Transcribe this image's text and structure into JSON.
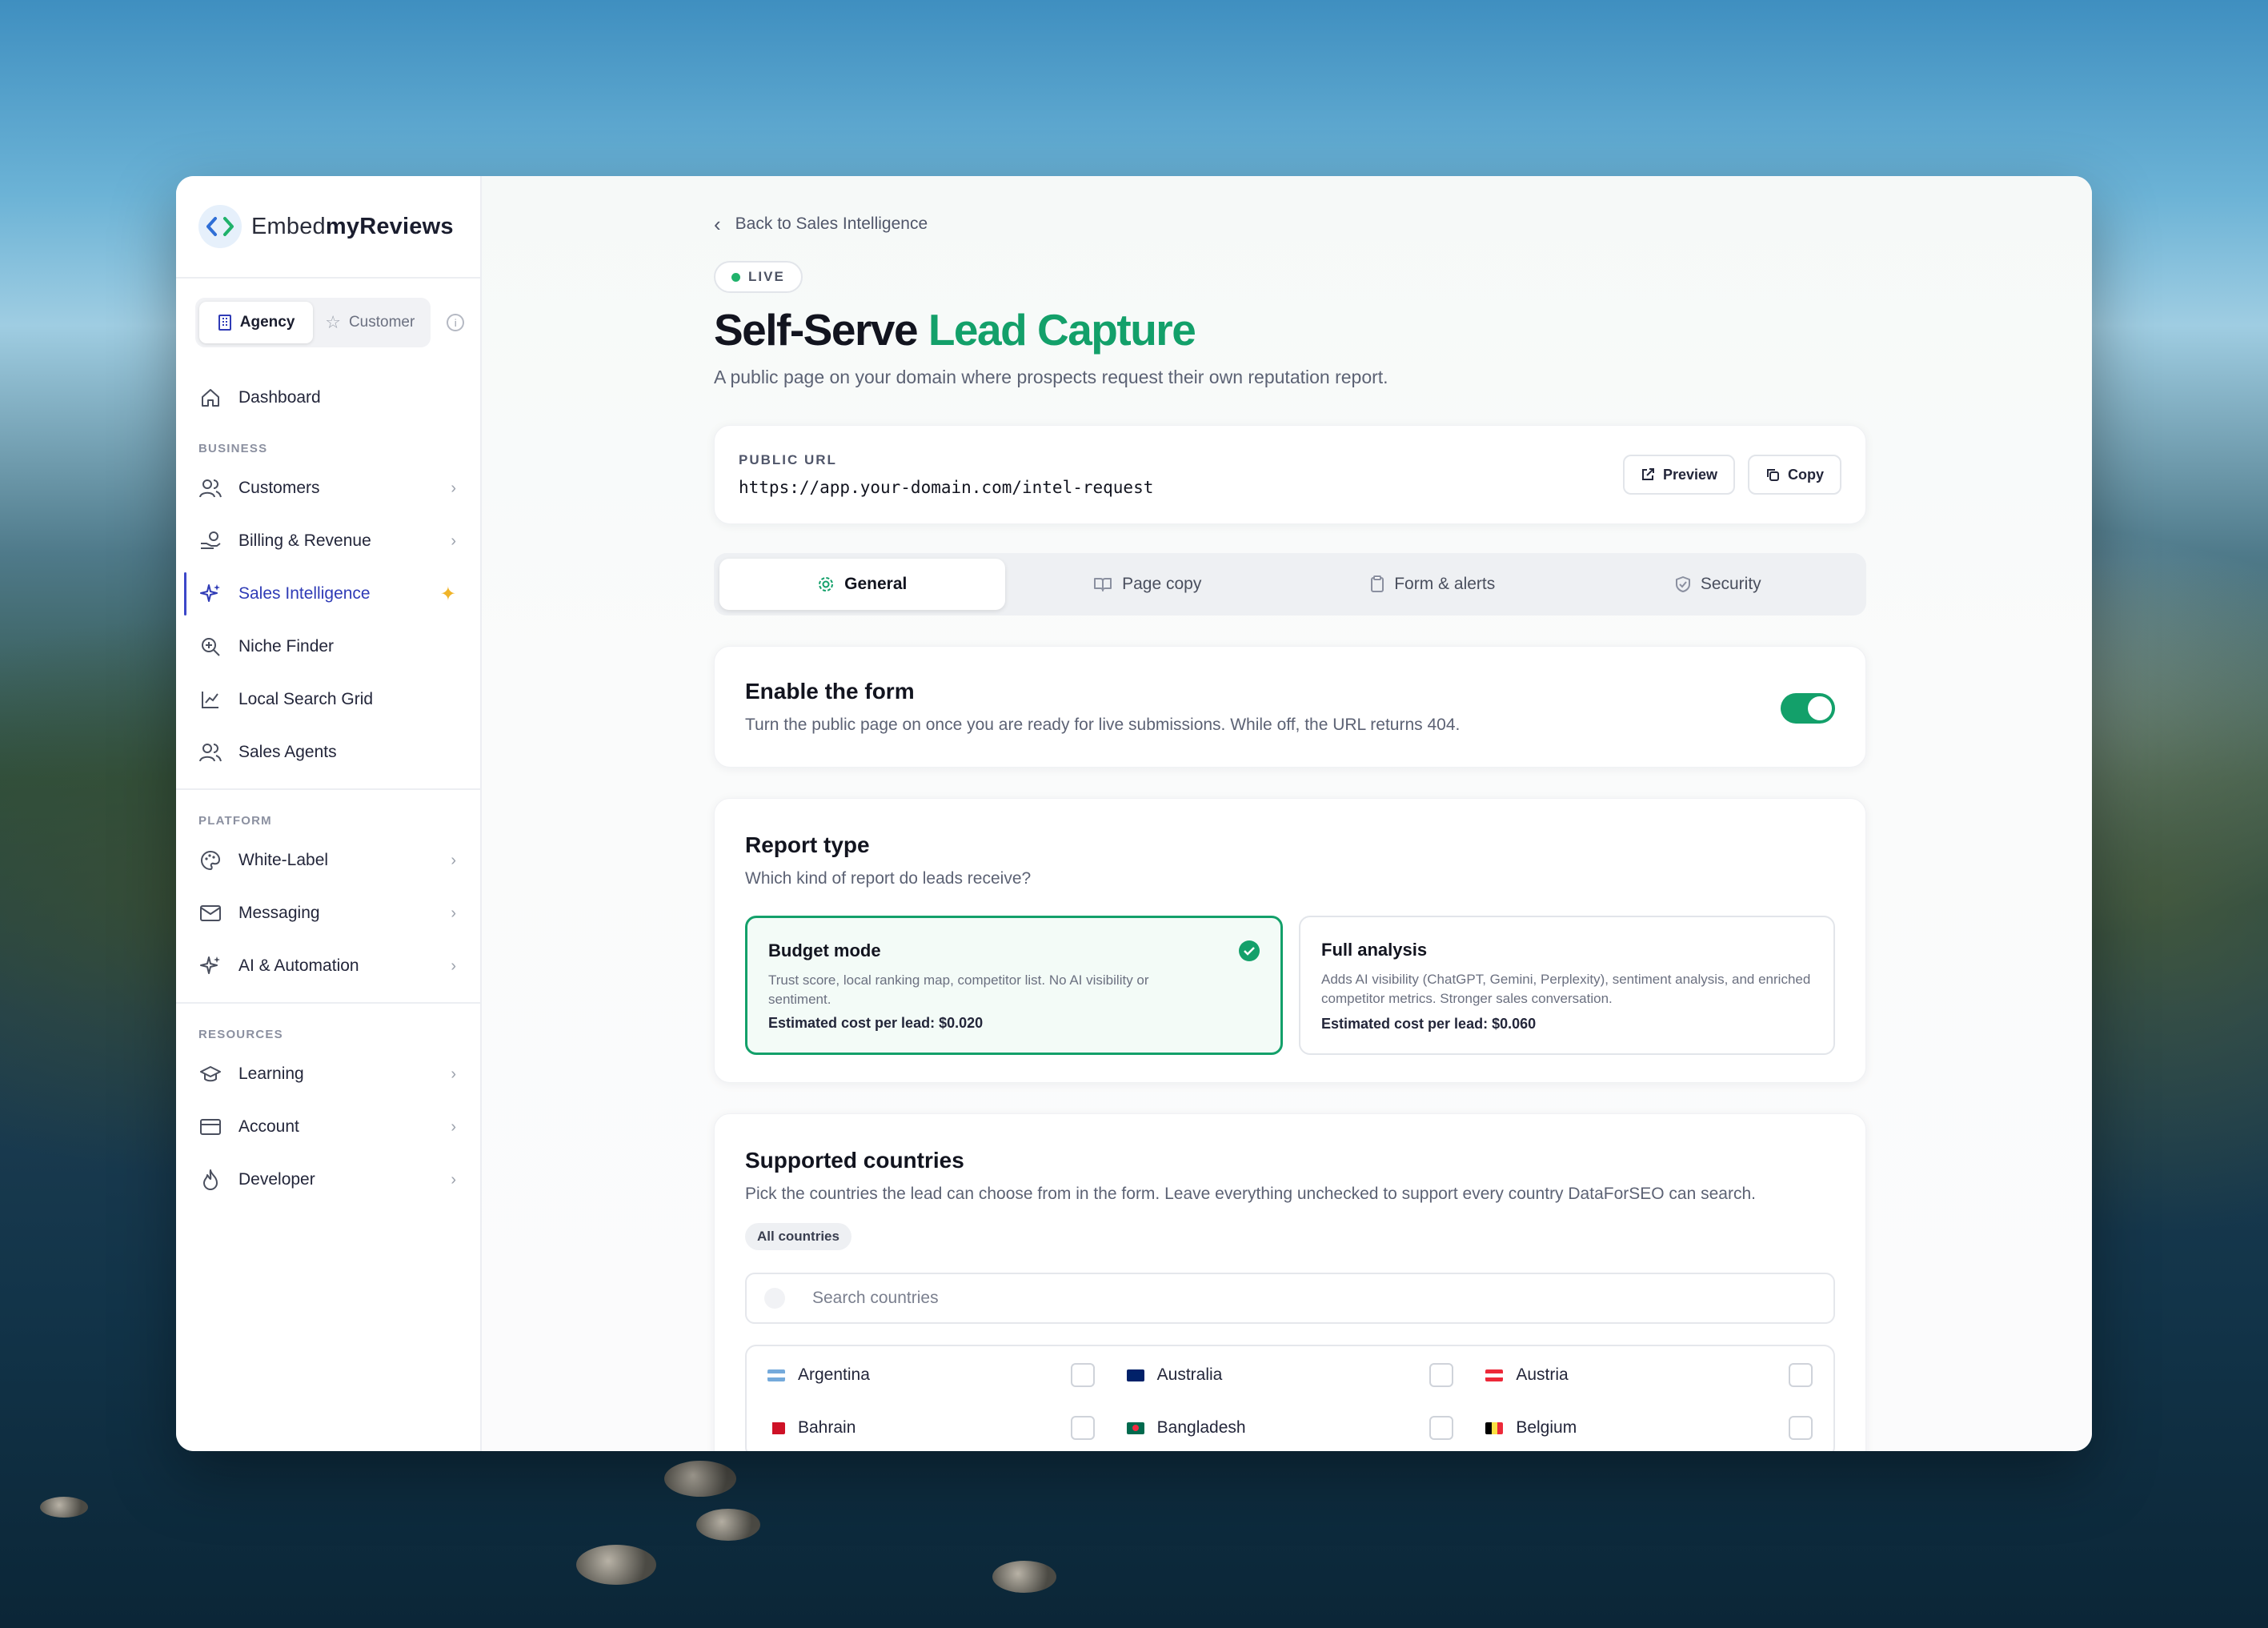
{
  "brand": {
    "prefix": "Embed",
    "bold": "myReviews"
  },
  "switcher": {
    "agency": "Agency",
    "customer": "Customer"
  },
  "nav": {
    "dashboard": "Dashboard",
    "business_label": "BUSINESS",
    "customers": "Customers",
    "billing": "Billing & Revenue",
    "sales_intel": "Sales Intelligence",
    "niche": "Niche Finder",
    "local_grid": "Local Search Grid",
    "agents": "Sales Agents",
    "platform_label": "PLATFORM",
    "white_label": "White-Label",
    "messaging": "Messaging",
    "ai": "AI & Automation",
    "resources_label": "RESOURCES",
    "learning": "Learning",
    "account": "Account",
    "developer": "Developer"
  },
  "page": {
    "back": "Back to Sales Intelligence",
    "badge": "LIVE",
    "title_dark": "Self-Serve",
    "title_green": "Lead Capture",
    "subtitle": "A public page on your domain where prospects request their own reputation report."
  },
  "url_card": {
    "label": "PUBLIC URL",
    "value": "https://app.your-domain.com/intel-request",
    "preview": "Preview",
    "copy": "Copy"
  },
  "tabs": [
    "General",
    "Page copy",
    "Form & alerts",
    "Security"
  ],
  "enable": {
    "title": "Enable the form",
    "desc": "Turn the public page on once you are ready for live submissions. While off, the URL returns 404.",
    "enabled": true
  },
  "report": {
    "title": "Report type",
    "desc": "Which kind of report do leads receive?",
    "options": [
      {
        "title": "Budget mode",
        "desc": "Trust score, local ranking map, competitor list. No AI visibility or sentiment.",
        "cost": "Estimated cost per lead: $0.020",
        "selected": true
      },
      {
        "title": "Full analysis",
        "desc": "Adds AI visibility (ChatGPT, Gemini, Perplexity), sentiment analysis, and enriched competitor metrics. Stronger sales conversation.",
        "cost": "Estimated cost per lead: $0.060",
        "selected": false
      }
    ]
  },
  "countries": {
    "title": "Supported countries",
    "desc": "Pick the countries the lead can choose from in the form. Leave everything unchecked to support every country DataForSEO can search.",
    "chip": "All countries",
    "search_placeholder": "Search countries",
    "list": [
      "Argentina",
      "Australia",
      "Austria",
      "Bahrain",
      "Bangladesh",
      "Belgium"
    ]
  },
  "colors": {
    "accent_green": "#13a06a",
    "nav_active": "#2f3bb6"
  }
}
